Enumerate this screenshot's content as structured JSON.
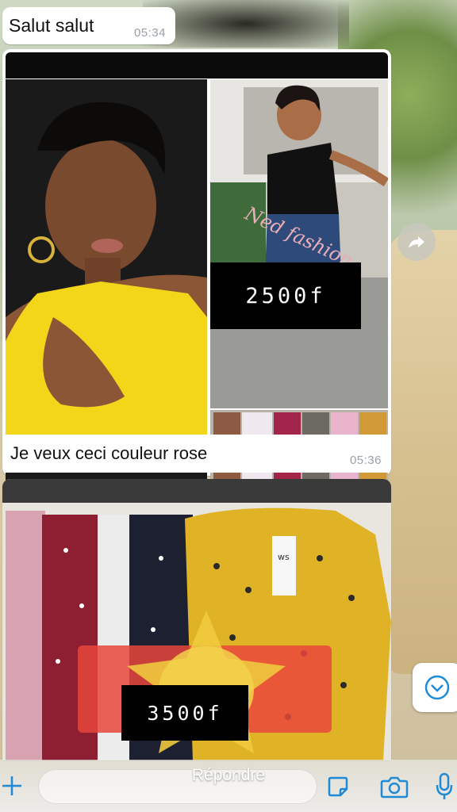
{
  "messages": [
    {
      "text": "Salut salut",
      "time": "05:34"
    },
    {
      "caption": "Je veux ceci couleur rose",
      "time": "05:36",
      "price": "2500f",
      "watermark": "Ned fashion"
    },
    {
      "price": "3500f",
      "tag": "ws"
    }
  ],
  "composer": {
    "reply_label": "Répondre"
  },
  "colors": {
    "bubble": "#ffffff",
    "timestamp": "#9aa0a6",
    "accent": "#1f8ad6"
  },
  "icons": [
    "plus-icon",
    "sticker-icon",
    "camera-icon",
    "microphone-icon",
    "forward-icon",
    "chevron-down-icon"
  ]
}
